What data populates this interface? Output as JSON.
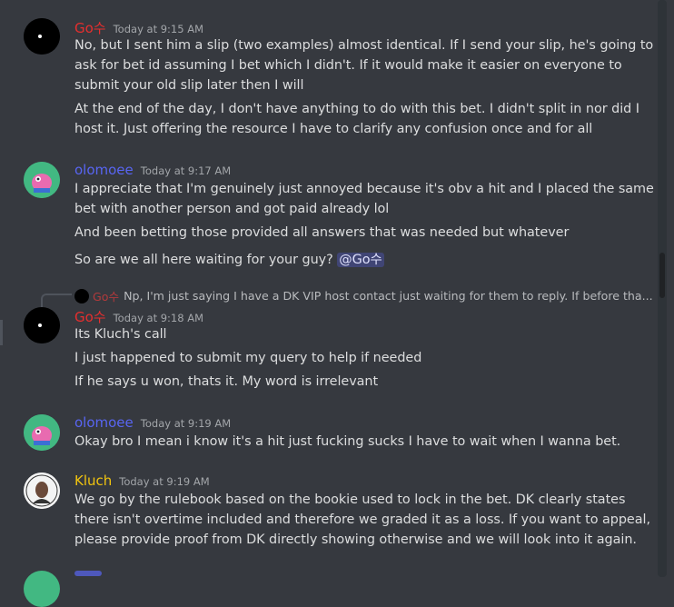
{
  "colors": {
    "background": "#36393f",
    "go_name": "#e62e2e",
    "olomoee_name": "#5865f2",
    "kluch_name": "#f1c40f"
  },
  "messages": [
    {
      "author": "Go수",
      "timestamp": "Today at 9:15 AM",
      "lines": [
        "No, but I sent him a slip (two examples) almost identical. If I send your slip, he's going to",
        "ask for bet id assuming I bet which I didn't. If it would make it easier on everyone to",
        "submit your old slip later then I will",
        "At the end of the day, I don't have anything to do with this bet. I didn't split in nor did I",
        "host it. Just offering the resource I have to clarify any confusion once and for all"
      ]
    },
    {
      "author": "olomoee",
      "timestamp": "Today at 9:17 AM",
      "lines": [
        "I appreciate that I'm genuinely just annoyed because it's obv a hit and I placed the same",
        "bet with another person and got paid already lol",
        "And been betting those provided all answers that was needed but whatever",
        "So are we all here waiting for your guy?"
      ],
      "mention": "@Go수"
    },
    {
      "reply": {
        "author": "Go수",
        "text": "Np, I'm just saying I have a DK VIP host contact just waiting for them to reply. If before tha..."
      },
      "author": "Go수",
      "timestamp": "Today at 9:18 AM",
      "lines": [
        "Its Kluch's call",
        "I just happened to submit my query to help if needed",
        "If he says u won, thats it. My word is irrelevant"
      ]
    },
    {
      "author": "olomoee",
      "timestamp": "Today at 9:19 AM",
      "lines": [
        "Okay bro I mean i know it's a hit just fucking sucks I have to wait when I wanna bet."
      ]
    },
    {
      "author": "Kluch",
      "timestamp": "Today at 9:19 AM",
      "lines": [
        "We go by the rulebook based on the bookie used to lock in the bet. DK clearly states",
        "there isn't overtime included  and therefore we graded it as a loss. If you want to appeal,",
        "please provide proof from DK directly showing otherwise and we will look into it again."
      ]
    }
  ]
}
